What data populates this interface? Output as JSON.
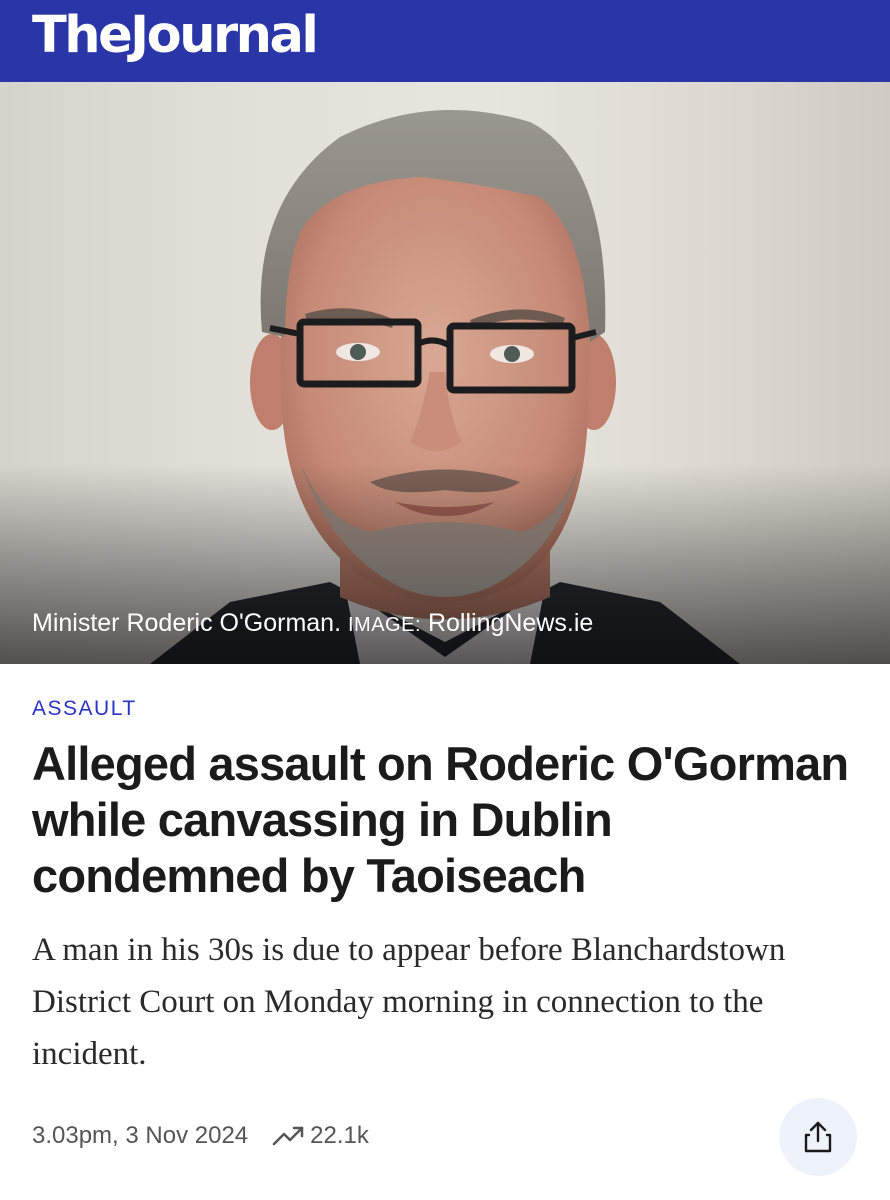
{
  "masthead": {
    "logo_text": "TheJournal"
  },
  "hero": {
    "caption": "Minister Roderic O'Gorman.",
    "credit_label": "IMAGE:",
    "credit": "RollingNews.ie"
  },
  "article": {
    "section": "ASSAULT",
    "headline": "Alleged assault on Roderic O'Gorman while canvassing in Dublin condemned by Taoiseach",
    "standfirst": "A man in his 30s is due to appear before Blanchardstown District Court on Monday morning in connection to the incident.",
    "timestamp": "3.03pm, 3 Nov 2024",
    "views": "22.1k"
  },
  "icons": {
    "views": "trending-up-icon",
    "share": "share-icon"
  },
  "colors": {
    "brand": "#2a35a8",
    "section": "#2a35c8",
    "share_bg": "#eef3fb"
  }
}
